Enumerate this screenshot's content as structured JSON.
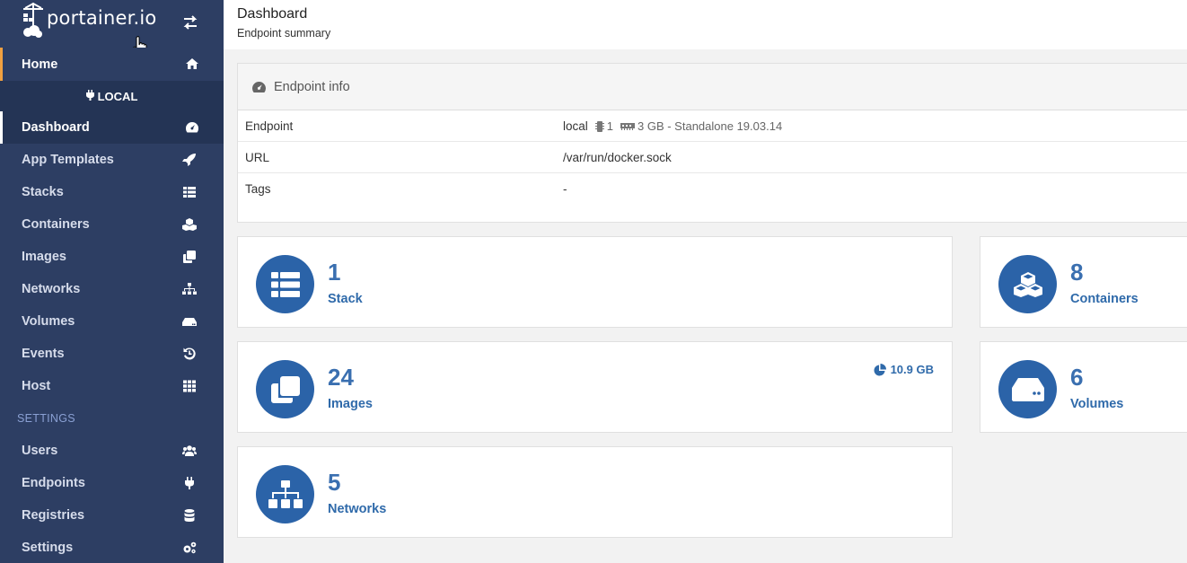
{
  "brand": {
    "name": "portainer.io"
  },
  "sidebar": {
    "home": "Home",
    "endpoint_label": "LOCAL",
    "items": [
      {
        "label": "Dashboard",
        "icon": "tachometer-icon"
      },
      {
        "label": "App Templates",
        "icon": "rocket-icon"
      },
      {
        "label": "Stacks",
        "icon": "th-list-icon"
      },
      {
        "label": "Containers",
        "icon": "cubes-icon"
      },
      {
        "label": "Images",
        "icon": "clone-icon"
      },
      {
        "label": "Networks",
        "icon": "sitemap-icon"
      },
      {
        "label": "Volumes",
        "icon": "hdd-icon"
      },
      {
        "label": "Events",
        "icon": "history-icon"
      },
      {
        "label": "Host",
        "icon": "th-icon"
      }
    ],
    "settings_header": "SETTINGS",
    "settings_items": [
      {
        "label": "Users",
        "icon": "users-icon"
      },
      {
        "label": "Endpoints",
        "icon": "plug-icon"
      },
      {
        "label": "Registries",
        "icon": "database-icon"
      },
      {
        "label": "Settings",
        "icon": "cogs-icon"
      }
    ]
  },
  "header": {
    "title": "Dashboard",
    "subtitle": "Endpoint summary"
  },
  "endpoint_info": {
    "title": "Endpoint info",
    "rows": [
      {
        "key": "Endpoint",
        "value": "local",
        "cpu": "1",
        "memory": "3 GB - Standalone 19.03.14"
      },
      {
        "key": "URL",
        "value": "/var/run/docker.sock"
      },
      {
        "key": "Tags",
        "value": "-"
      }
    ]
  },
  "widgets": {
    "stacks": {
      "count": "1",
      "label": "Stack"
    },
    "containers": {
      "count": "8",
      "label": "Containers"
    },
    "images": {
      "count": "24",
      "label": "Images",
      "size": "10.9 GB"
    },
    "volumes": {
      "count": "6",
      "label": "Volumes"
    },
    "networks": {
      "count": "5",
      "label": "Networks"
    }
  },
  "colors": {
    "sidebar": "#2d3e63",
    "accent": "#2b63a8",
    "home_marker": "#f0a040"
  }
}
